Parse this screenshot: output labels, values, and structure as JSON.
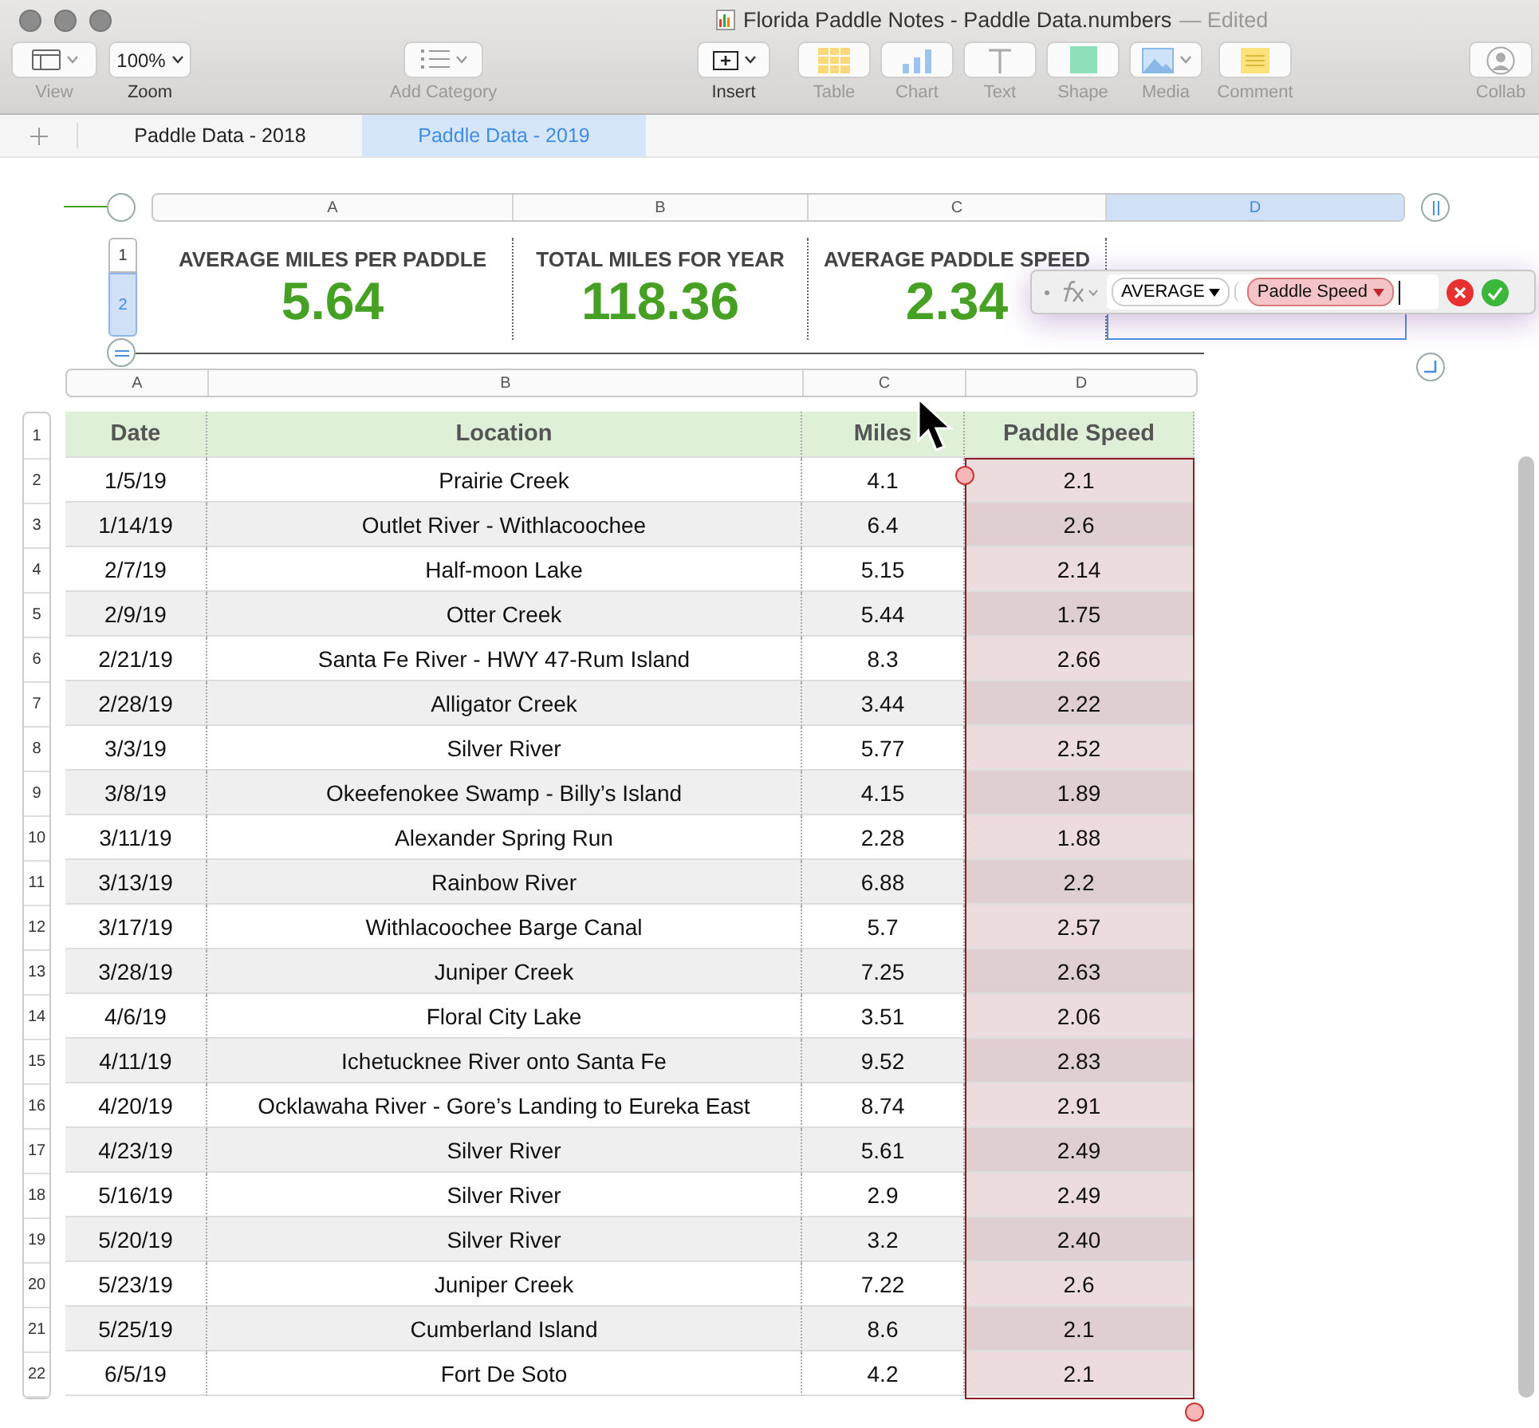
{
  "window": {
    "title": "Florida Paddle Notes - Paddle Data.numbers",
    "status": "— Edited"
  },
  "toolbar": [
    {
      "kind": "view",
      "label": "View",
      "disabled": true
    },
    {
      "kind": "zoom",
      "label": "Zoom",
      "value": "100%",
      "disabled": false
    },
    {
      "kind": "category",
      "label": "Add Category",
      "disabled": true
    },
    {
      "kind": "insert",
      "label": "Insert",
      "disabled": false
    },
    {
      "kind": "table",
      "label": "Table",
      "disabled": true
    },
    {
      "kind": "chart",
      "label": "Chart",
      "disabled": true
    },
    {
      "kind": "text",
      "label": "Text",
      "disabled": true
    },
    {
      "kind": "shape",
      "label": "Shape",
      "disabled": true
    },
    {
      "kind": "media",
      "label": "Media",
      "disabled": true
    },
    {
      "kind": "comment",
      "label": "Comment",
      "disabled": true
    },
    {
      "kind": "collab",
      "label": "Collab",
      "disabled": true
    }
  ],
  "sheets": [
    {
      "label": "Paddle Data - 2018",
      "selected": false
    },
    {
      "label": "Paddle Data - 2019",
      "selected": true
    }
  ],
  "summary_table": {
    "columns": [
      {
        "letter": "A",
        "selected": false
      },
      {
        "letter": "B",
        "selected": false
      },
      {
        "letter": "C",
        "selected": false
      },
      {
        "letter": "D",
        "selected": true
      }
    ],
    "rows": [
      {
        "number": "1",
        "selected": false
      },
      {
        "number": "2",
        "selected": true
      }
    ],
    "cells": [
      {
        "label": "AVERAGE MILES PER PADDLE",
        "value": "5.64"
      },
      {
        "label": "TOTAL MILES FOR YEAR",
        "value": "118.36"
      },
      {
        "label": "AVERAGE PADDLE SPEED",
        "value": "2.34"
      }
    ]
  },
  "formula_editor": {
    "function": "AVERAGE",
    "argument": "Paddle Speed"
  },
  "data_table": {
    "columns": [
      {
        "letter": "A",
        "heading": "Date",
        "selected": false
      },
      {
        "letter": "B",
        "heading": "Location",
        "selected": false
      },
      {
        "letter": "C",
        "heading": "Miles",
        "selected": false
      },
      {
        "letter": "D",
        "heading": "Paddle Speed",
        "selected": true
      }
    ],
    "header_number": "1",
    "rows": [
      {
        "number": "2",
        "date": "1/5/19",
        "location": "Prairie Creek",
        "miles": "4.1",
        "speed": "2.1"
      },
      {
        "number": "3",
        "date": "1/14/19",
        "location": "Outlet River - Withlacoochee",
        "miles": "6.4",
        "speed": "2.6"
      },
      {
        "number": "4",
        "date": "2/7/19",
        "location": "Half-moon Lake",
        "miles": "5.15",
        "speed": "2.14"
      },
      {
        "number": "5",
        "date": "2/9/19",
        "location": "Otter Creek",
        "miles": "5.44",
        "speed": "1.75"
      },
      {
        "number": "6",
        "date": "2/21/19",
        "location": "Santa Fe River - HWY 47-Rum Island",
        "miles": "8.3",
        "speed": "2.66"
      },
      {
        "number": "7",
        "date": "2/28/19",
        "location": "Alligator Creek",
        "miles": "3.44",
        "speed": "2.22"
      },
      {
        "number": "8",
        "date": "3/3/19",
        "location": "Silver River",
        "miles": "5.77",
        "speed": "2.52"
      },
      {
        "number": "9",
        "date": "3/8/19",
        "location": "Okeefenokee Swamp - Billy’s Island",
        "miles": "4.15",
        "speed": "1.89"
      },
      {
        "number": "10",
        "date": "3/11/19",
        "location": "Alexander Spring Run",
        "miles": "2.28",
        "speed": "1.88"
      },
      {
        "number": "11",
        "date": "3/13/19",
        "location": "Rainbow River",
        "miles": "6.88",
        "speed": "2.2"
      },
      {
        "number": "12",
        "date": "3/17/19",
        "location": "Withlacoochee Barge Canal",
        "miles": "5.7",
        "speed": "2.57"
      },
      {
        "number": "13",
        "date": "3/28/19",
        "location": "Juniper Creek",
        "miles": "7.25",
        "speed": "2.63"
      },
      {
        "number": "14",
        "date": "4/6/19",
        "location": "Floral City Lake",
        "miles": "3.51",
        "speed": "2.06"
      },
      {
        "number": "15",
        "date": "4/11/19",
        "location": "Ichetucknee River onto Santa Fe",
        "miles": "9.52",
        "speed": "2.83"
      },
      {
        "number": "16",
        "date": "4/20/19",
        "location": "Ocklawaha River - Gore’s Landing to Eureka East",
        "miles": "8.74",
        "speed": "2.91"
      },
      {
        "number": "17",
        "date": "4/23/19",
        "location": "Silver River",
        "miles": "5.61",
        "speed": "2.49"
      },
      {
        "number": "18",
        "date": "5/16/19",
        "location": "Silver River",
        "miles": "2.9",
        "speed": "2.49"
      },
      {
        "number": "19",
        "date": "5/20/19",
        "location": "Silver River",
        "miles": "3.2",
        "speed": "2.40"
      },
      {
        "number": "20",
        "date": "5/23/19",
        "location": "Juniper Creek",
        "miles": "7.22",
        "speed": "2.6"
      },
      {
        "number": "21",
        "date": "5/25/19",
        "location": "Cumberland Island",
        "miles": "8.6",
        "speed": "2.1"
      },
      {
        "number": "22",
        "date": "6/5/19",
        "location": "Fort De Soto",
        "miles": "4.2",
        "speed": "2.1"
      }
    ]
  }
}
